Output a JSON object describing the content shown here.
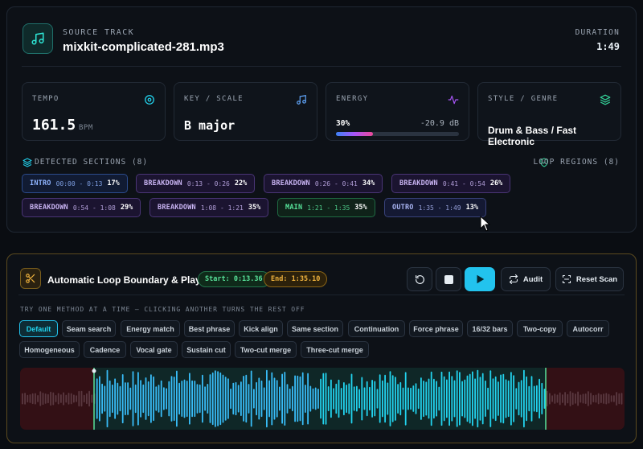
{
  "source": {
    "label": "SOURCE TRACK",
    "filename": "mixkit-complicated-281.mp3",
    "duration_label": "DURATION",
    "duration": "1:49"
  },
  "stats": {
    "tempo": {
      "label": "TEMPO",
      "value": "161.5",
      "unit": "BPM",
      "icon": "target-icon"
    },
    "key": {
      "label": "KEY / SCALE",
      "value": "B major",
      "icon": "music-note-icon"
    },
    "energy": {
      "label": "ENERGY",
      "percent": "30%",
      "fraction": 0.3,
      "db": "-20.9 dB",
      "icon": "pulse-icon"
    },
    "genre": {
      "label": "STYLE / GENRE",
      "value": "Drum & Bass / Fast Electronic",
      "icon": "layers-icon"
    }
  },
  "sections": {
    "label": "DETECTED SECTIONS (8)",
    "loop_label": "LOOP REGIONS (8)",
    "items": [
      {
        "name": "INTRO",
        "time": "00:00 - 0:13",
        "pct": "17%",
        "kind": "intro"
      },
      {
        "name": "BREAKDOWN",
        "time": "0:13 - 0:26",
        "pct": "22%",
        "kind": "break"
      },
      {
        "name": "BREAKDOWN",
        "time": "0:26 - 0:41",
        "pct": "34%",
        "kind": "break"
      },
      {
        "name": "BREAKDOWN",
        "time": "0:41 - 0:54",
        "pct": "26%",
        "kind": "break"
      },
      {
        "name": "BREAKDOWN",
        "time": "0:54 - 1:08",
        "pct": "29%",
        "kind": "break"
      },
      {
        "name": "BREAKDOWN",
        "time": "1:08 - 1:21",
        "pct": "35%",
        "kind": "break"
      },
      {
        "name": "MAIN",
        "time": "1:21 - 1:35",
        "pct": "35%",
        "kind": "main"
      },
      {
        "name": "OUTRO",
        "time": "1:35 - 1:49",
        "pct": "13%",
        "kind": "outro"
      }
    ]
  },
  "player": {
    "title": "Automatic Loop Boundary & Player",
    "start": "Start: 0:13.36",
    "end": "End: 1:35.10",
    "audit_label": "Audit",
    "reset_label": "Reset Scan",
    "hint": "TRY ONE METHOD AT A TIME — CLICKING ANOTHER TURNS THE REST OFF",
    "methods": [
      "Default",
      "Seam search",
      "Energy match",
      "Best phrase",
      "Kick align",
      "Same section",
      "Continuation",
      "Force phrase",
      "16/32 bars",
      "Two-copy",
      "Autocorr",
      "Homogeneous",
      "Cadence",
      "Vocal gate",
      "Sustain cut",
      "Two-cut merge",
      "Three-cut merge"
    ],
    "active_method": "Default"
  },
  "colors": {
    "accent": "#22c3ee",
    "loop_start": "#58e29a",
    "loop_end": "#f0b33e"
  }
}
